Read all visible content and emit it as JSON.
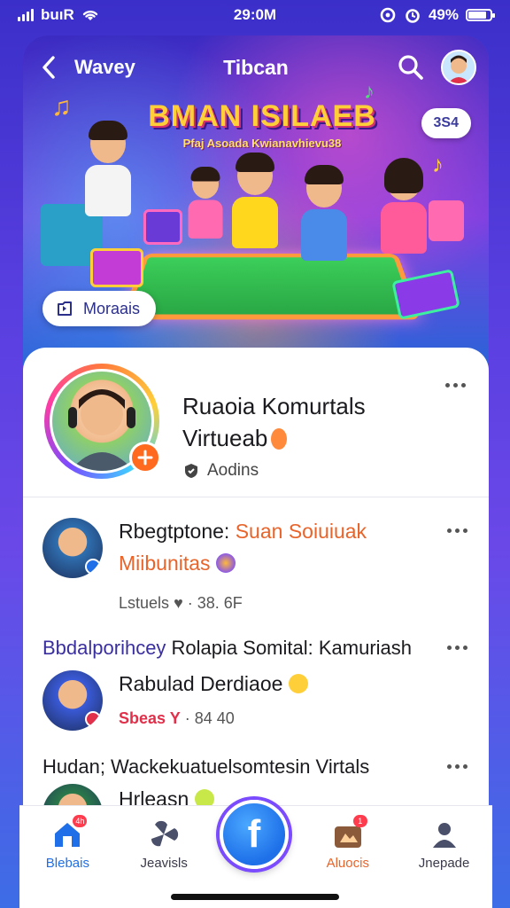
{
  "status_bar": {
    "carrier": "buıR",
    "time": "29:0M",
    "battery": "49%",
    "battery_level": 0.85
  },
  "header": {
    "back_icon": "chevron-left-icon",
    "app_name": "Wavey",
    "title": "Tibcan",
    "search_icon": "search-icon"
  },
  "hero": {
    "banner_title": "BMAN ISILAEB",
    "banner_subtitle": "Pfaj Asoada Kwianavhievu38",
    "chip_label": "3S4",
    "moments_label": "Moraais",
    "moments_icon": "bookmark-icon"
  },
  "profile": {
    "name_line1": "Ruaoia Komurtals",
    "name_line2": "Virtueab",
    "meta": "Aodins",
    "meta_icon": "shield-icon",
    "add_icon": "plus-icon"
  },
  "posts": [
    {
      "prefix": "Rbegtptone: ",
      "highlight": "Suan Soiuiuak",
      "line2": "Miibunitas",
      "meta_label": "Lstuels",
      "meta_value": "· 38. 6F"
    },
    {
      "heading_prefix": "Bbdalporihcey ",
      "heading_rest": "Rolapia Somital: Kamuriash",
      "line2": "Rabulad Derdiaoe",
      "meta_label": "Sbeas Y",
      "meta_value": "· 84 40"
    },
    {
      "heading": "Hudan; Wackekuatuelsomtesin Virtals",
      "line2": "Hrleasn"
    }
  ],
  "bottom_nav": {
    "items": [
      {
        "label": "Blebais",
        "icon": "home-icon",
        "badge": "4h"
      },
      {
        "label": "Jeavisls",
        "icon": "pinwheel-icon"
      },
      {
        "label": "Aluocis",
        "icon": "photo-album-icon",
        "badge": "1"
      },
      {
        "label": "Jnepade",
        "icon": "profile-icon"
      }
    ],
    "center_label": "f",
    "center_icon": "create-icon"
  },
  "colors": {
    "accent_orange": "#e8642a",
    "accent_blue": "#1e6fe8",
    "accent_purple": "#7a4bff"
  }
}
